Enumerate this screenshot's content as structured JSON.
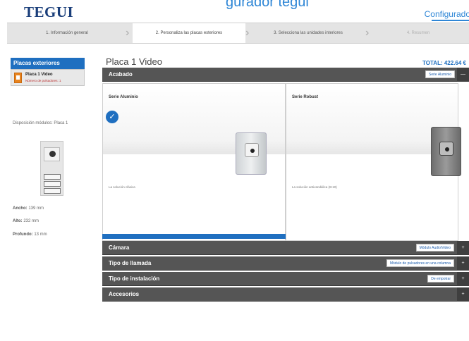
{
  "header": {
    "logo": "TEGUI",
    "title_fragment": "gurador tegui",
    "config_link": "Configurado"
  },
  "steps": [
    {
      "label": "1. Información general",
      "state": "done"
    },
    {
      "label": "2. Personaliza las placas exteriores",
      "state": "active"
    },
    {
      "label": "3. Selecciona las unidades interiores",
      "state": "pending"
    },
    {
      "label": "4. Resumen",
      "state": "disabled"
    }
  ],
  "sidebar": {
    "heading": "Placas exteriores",
    "item": {
      "name": "Placa 1 Video",
      "sub": "Número de pulsadores: 1"
    },
    "disposition_label": "Disposición módulos: Placa 1",
    "dims": [
      {
        "key": "Ancho:",
        "value": "139 mm"
      },
      {
        "key": "Alto:",
        "value": "232 mm"
      },
      {
        "key": "Profundo:",
        "value": "13 mm"
      }
    ]
  },
  "panel": {
    "title": "Placa 1 Video",
    "total": "TOTAL: 422.64 €"
  },
  "sections": [
    {
      "label": "Acabado",
      "value": "Serie Aluminio",
      "toggle": "—"
    },
    {
      "label": "Cámara",
      "value": "Módulo Audio/Video",
      "toggle": "+"
    },
    {
      "label": "Tipo de llamada",
      "value": "Módulo de pulsadores en una columna",
      "toggle": "+"
    },
    {
      "label": "Tipo de instalación",
      "value": "De empotrar",
      "toggle": "+"
    },
    {
      "label": "Accesorios",
      "value": "",
      "toggle": "+"
    }
  ],
  "options": [
    {
      "name": "Serie Aluminio",
      "caption": "La solución clásica",
      "selected": true
    },
    {
      "name": "Serie Robust",
      "caption": "La solución antivandálica (IK10)",
      "selected": false
    }
  ],
  "icons": {
    "check": "✓",
    "chevron": "›"
  },
  "colors": {
    "brand": "#1a3e7a",
    "accent": "#1f6fc0",
    "section_bar": "#555555",
    "sidebar_icon": "#e8841f"
  }
}
